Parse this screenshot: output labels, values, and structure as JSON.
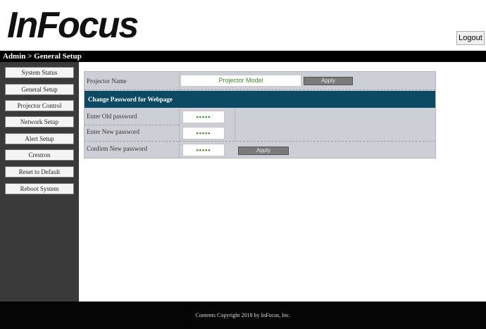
{
  "header": {
    "logo_text": "InFocus",
    "logout_label": "Logout"
  },
  "breadcrumb": "Admin > General Setup",
  "sidebar": {
    "items": [
      {
        "label": "System Status"
      },
      {
        "label": "General Setup"
      },
      {
        "label": "Projector Control"
      },
      {
        "label": "Network Setup"
      },
      {
        "label": "Alert Setup"
      },
      {
        "label": "Crestron"
      },
      {
        "label": "Reset to Default"
      },
      {
        "label": "Reboot System"
      }
    ]
  },
  "general": {
    "projector_name_label": "Projector Name",
    "projector_name_value": "Projector Model",
    "apply_label": "Apply"
  },
  "password": {
    "section_title": "Change Password for Webpage",
    "old_label": "Enter Old password",
    "old_value": "•••••",
    "new_label": "Enter New password",
    "new_value": "•••••",
    "confirm_label": "Confirm New password",
    "confirm_value": "•••••",
    "apply_label": "Apply"
  },
  "footer": {
    "copyright": "Contents Copyright 2018 by InFocus, Inc."
  }
}
